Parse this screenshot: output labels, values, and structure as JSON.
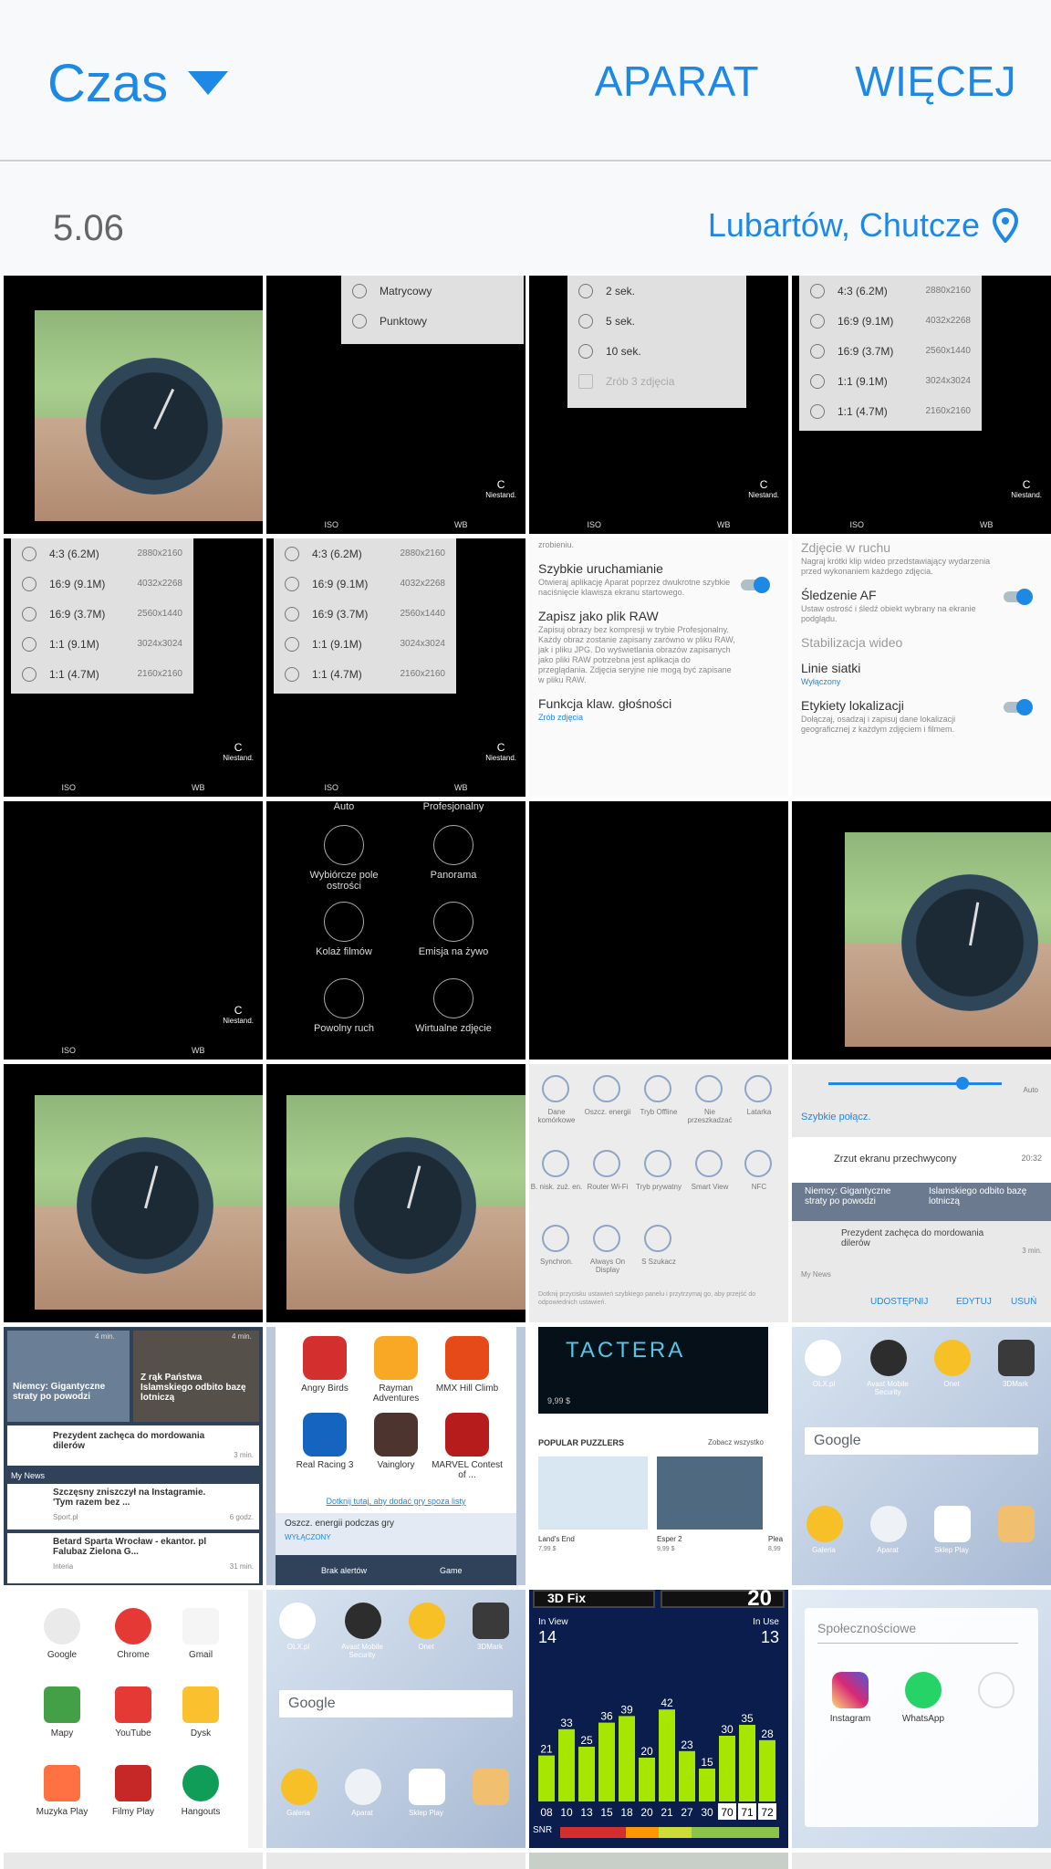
{
  "header": {
    "view_selector": "Czas",
    "camera_action": "APARAT",
    "more_action": "WIĘCEJ"
  },
  "group": {
    "date": "5.06",
    "location": "Lubartów, Chutcze"
  },
  "thumbs": {
    "metering": {
      "items": [
        "Matrycowy",
        "Punktowy"
      ]
    },
    "timer": {
      "items": [
        "2 sek.",
        "5 sek.",
        "10 sek.",
        "Zrób 3 zdjęcia"
      ]
    },
    "resolutions": {
      "items": [
        {
          "label": "4:3 (6.2M)",
          "res": "2880x2160"
        },
        {
          "label": "16:9 (9.1M)",
          "res": "4032x2268"
        },
        {
          "label": "16:9 (3.7M)",
          "res": "2560x1440"
        },
        {
          "label": "1:1 (9.1M)",
          "res": "3024x3024"
        },
        {
          "label": "1:1 (4.7M)",
          "res": "2160x2160"
        }
      ]
    },
    "camera_mode_badge": "C",
    "camera_mode_sub": "Niestand.",
    "camera_bar": [
      "ISO",
      "WB"
    ],
    "settings_a": {
      "top": "zrobieniu.",
      "items": [
        {
          "title": "Szybkie uruchamianie",
          "sub": "Otwieraj aplikację Aparat poprzez dwukrotne szybkie naciśnięcie klawisza ekranu startowego."
        },
        {
          "title": "Zapisz jako plik RAW",
          "sub": "Zapisuj obrazy bez kompresji w trybie Profesjonalny. Każdy obraz zostanie zapisany zarówno w pliku RAW, jak i pliku JPG. Do wyświetlania obrazów zapisanych jako pliki RAW potrzebna jest aplikacja do przeglądania. Zdjęcia seryjne nie mogą być zapisane w pliku RAW."
        },
        {
          "title": "Funkcja klaw. głośności",
          "sub": "Zrób zdjęcia"
        }
      ]
    },
    "settings_b": {
      "items": [
        {
          "title": "Zdjęcie w ruchu",
          "sub": "Nagraj krótki klip wideo przedstawiający wydarzenia przed wykonaniem każdego zdjęcia."
        },
        {
          "title": "Śledzenie AF",
          "sub": "Ustaw ostrość i śledź obiekt wybrany na ekranie podglądu."
        },
        {
          "title": "Stabilizacja wideo",
          "sub": ""
        },
        {
          "title": "Linie siatki",
          "sub": "Wyłączony"
        },
        {
          "title": "Etykiety lokalizacji",
          "sub": "Dołączaj, osadzaj i zapisuj dane lokalizacji geograficznej z każdym zdjęciem i filmem."
        }
      ]
    },
    "modes": {
      "top_left": "Auto",
      "top_right": "Profesjonalny",
      "items": [
        "Wybiórcze pole ostrości",
        "Panorama",
        "Kolaż filmów",
        "Emisja na żywo",
        "Powolny ruch",
        "Wirtualne zdjęcie"
      ]
    },
    "quick_settings": {
      "items": [
        "Dane komórkowe",
        "Oszcz. energii",
        "Tryb Offline",
        "Nie przeszkadzać",
        "Latarka",
        "B. nisk. zuż. en.",
        "Router Wi-Fi",
        "Tryb prywatny",
        "Smart View",
        "NFC",
        "Synchron.",
        "Always On Display",
        "S Szukacz"
      ],
      "footer": "Dotknij przycisku ustawień szybkiego panelu i przytrzymaj go, aby przejść do odpowiednich ustawień."
    },
    "notification": {
      "auto": "Auto",
      "quick_connect": "Szybkie połącz.",
      "screenshot_title": "Zrzut ekranu przechwycony",
      "screenshot_time": "20:32",
      "news1": "Niemcy: Gigantyczne straty po powodzi",
      "news2": "Islamskiego odbito bazę lotniczą",
      "news3": "Prezydent zachęca do mordowania dilerów",
      "news3_time": "3 min.",
      "source": "My News",
      "actions": [
        "UDOSTĘPNIJ",
        "EDYTUJ",
        "USUŃ"
      ]
    },
    "news_app": {
      "card1": "Niemcy: Gigantyczne straty po powodzi",
      "card1_time": "4 min.",
      "card2": "Z rąk Państwa Islamskiego odbito bazę lotniczą",
      "card2_time": "4 min.",
      "item1": "Prezydent zachęca do mordowania dilerów",
      "item1_time": "3 min.",
      "section": "My News",
      "item2": "Szczęsny zniszczył na Instagramie. 'Tym razem bez ...",
      "item2_src": "Sport.pl",
      "item2_time": "6 godz.",
      "item3": "Betard Sparta Wrocław - ekantor. pl Falubaz Zielona G...",
      "item3_src": "Interia",
      "item3_time": "31 min."
    },
    "games": {
      "items": [
        "Angry Birds",
        "Rayman Adventures",
        "MMX Hill Climb",
        "Real Racing 3",
        "Vainglory",
        "MARVEL Contest of ..."
      ],
      "link": "Dotknij tutaj, aby dodać gry spoza listy",
      "power": "Oszcz. energii podczas gry",
      "power_state": "WYŁĄCZONY",
      "no_alerts": "Brak alertów",
      "game": "Game"
    },
    "store": {
      "banner": "TACTERA",
      "price1": "9,99 $",
      "section": "POPULAR PUZZLERS",
      "see_all": "Zobacz wszystko",
      "items": [
        {
          "name": "Land's End",
          "price": "7,99 $"
        },
        {
          "name": "Esper 2",
          "price": "9,99 $"
        },
        {
          "name": "Plea",
          "price": "8,99"
        }
      ]
    },
    "home1": {
      "top": [
        "OLX.pl",
        "Avast Mobile Security",
        "Onet",
        "3DMark"
      ],
      "google": "Google",
      "dock": [
        "Galeria",
        "Aparat",
        "Sklep Play",
        ""
      ]
    },
    "drawer": {
      "items": [
        "Google",
        "Chrome",
        "Gmail",
        "Mapy",
        "YouTube",
        "Dysk",
        "Muzyka Play",
        "Filmy Play",
        "Hangouts"
      ]
    },
    "gps": {
      "top": "3D Fix",
      "top_right": "20",
      "in_view_label": "In View",
      "in_view": "14",
      "in_use_label": "In Use",
      "in_use": "13",
      "bar_values": [
        21,
        33,
        25,
        36,
        39,
        20,
        42,
        23,
        15,
        30,
        35,
        28
      ],
      "prns": [
        "08",
        "10",
        "13",
        "15",
        "18",
        "20",
        "21",
        "27",
        "30",
        "70",
        "71",
        "72"
      ],
      "snr": "SNR"
    },
    "social": {
      "title": "Społecznościowe",
      "items": [
        "Instagram",
        "WhatsApp"
      ]
    }
  },
  "colors": {
    "accent": "#1e88e5",
    "appbar": "#f8f9fa",
    "divider": "#cfcfcf"
  }
}
